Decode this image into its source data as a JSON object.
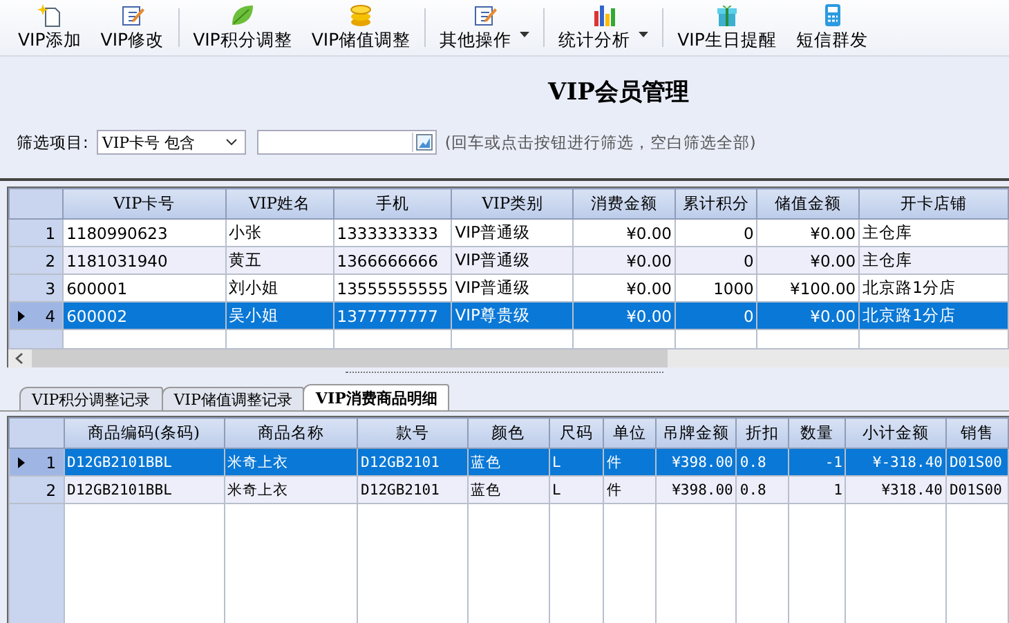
{
  "toolbar": [
    {
      "label": "VIP添加",
      "dropdown": false
    },
    {
      "label": "VIP修改",
      "dropdown": false
    },
    {
      "label": "VIP积分调整",
      "dropdown": false
    },
    {
      "label": "VIP储值调整",
      "dropdown": false
    },
    {
      "label": "其他操作",
      "dropdown": true
    },
    {
      "label": "统计分析",
      "dropdown": true
    },
    {
      "label": "VIP生日提醒",
      "dropdown": false
    },
    {
      "label": "短信群发",
      "dropdown": false
    }
  ],
  "title": "VIP会员管理",
  "filter": {
    "label": "筛选项目:",
    "select_value": "VIP卡号 包含",
    "hint": "(回车或点击按钮进行筛选，空白筛选全部)"
  },
  "members_table": {
    "columns": [
      "VIP卡号",
      "VIP姓名",
      "手机",
      "VIP类别",
      "消费金额",
      "累计积分",
      "储值金额",
      "开卡店铺"
    ],
    "rows": [
      {
        "index": "1",
        "cells": [
          "1180990623",
          "小张",
          "1333333333",
          "VIP普通级",
          "¥0.00",
          "0",
          "¥0.00",
          "主仓库"
        ],
        "selected": false
      },
      {
        "index": "2",
        "cells": [
          "1181031940",
          "黄五",
          "1366666666",
          "VIP普通级",
          "¥0.00",
          "0",
          "¥0.00",
          "主仓库"
        ],
        "selected": false
      },
      {
        "index": "3",
        "cells": [
          "600001",
          "刘小姐",
          "13555555555",
          "VIP普通级",
          "¥0.00",
          "1000",
          "¥100.00",
          "北京路1分店"
        ],
        "selected": false
      },
      {
        "index": "4",
        "cells": [
          "600002",
          "吴小姐",
          "1377777777",
          "VIP尊贵级",
          "¥0.00",
          "0",
          "¥0.00",
          "北京路1分店"
        ],
        "selected": true
      }
    ]
  },
  "tabs": [
    {
      "label": "VIP积分调整记录",
      "selected": false
    },
    {
      "label": "VIP储值调整记录",
      "selected": false
    },
    {
      "label": "VIP消费商品明细",
      "selected": true
    }
  ],
  "detail_table": {
    "columns": [
      "商品编码(条码)",
      "商品名称",
      "款号",
      "颜色",
      "尺码",
      "单位",
      "吊牌金额",
      "折扣",
      "数量",
      "小计金额",
      "销售"
    ],
    "rows": [
      {
        "index": "1",
        "cells": [
          "D12GB2101BBL",
          "米奇上衣",
          "D12GB2101",
          "蓝色",
          "L",
          "件",
          "¥398.00",
          "0.8",
          "-1",
          "¥-318.40",
          "D01S00"
        ],
        "selected": true
      },
      {
        "index": "2",
        "cells": [
          "D12GB2101BBL",
          "米奇上衣",
          "D12GB2101",
          "蓝色",
          "L",
          "件",
          "¥398.00",
          "0.8",
          "1",
          "¥318.40",
          "D01S00"
        ],
        "selected": false
      }
    ]
  }
}
